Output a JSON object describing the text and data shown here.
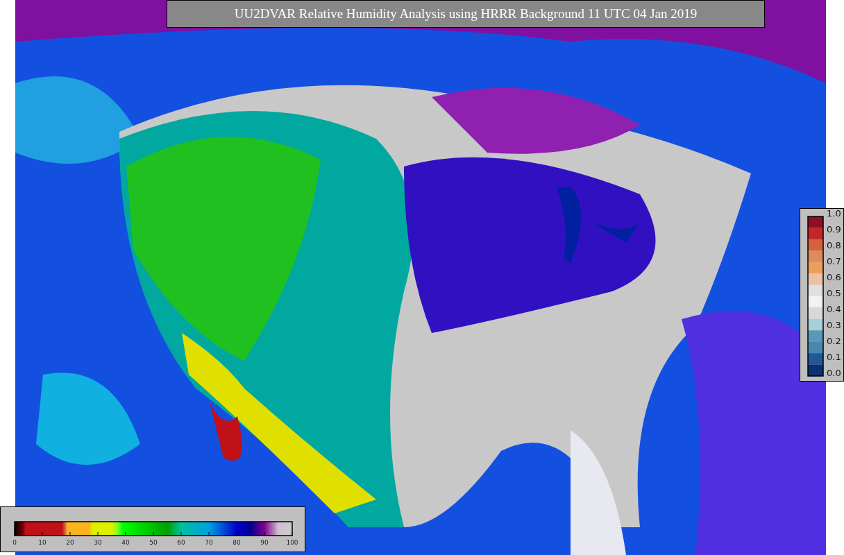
{
  "title": "UU2DVAR Relative Humidity Analysis using HRRR Background 11 UTC 04 Jan 2019",
  "humidity_legend": {
    "ticks": [
      "0",
      "10",
      "20",
      "30",
      "40",
      "50",
      "60",
      "70",
      "80",
      "90",
      "100"
    ]
  },
  "ratio_legend": {
    "ticks": [
      "1.0",
      "0.9",
      "0.8",
      "0.7",
      "0.6",
      "0.5",
      "0.4",
      "0.3",
      "0.2",
      "0.1",
      "0.0"
    ]
  }
}
